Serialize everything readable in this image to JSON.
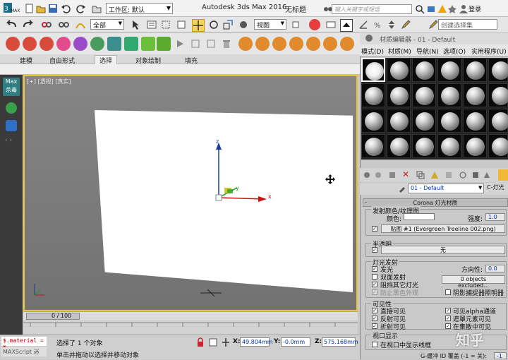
{
  "titlebar": {
    "workspace_label": "工作区: 默认",
    "app_title": "Autodesk 3ds Max 2016",
    "doc_title": "无标题",
    "search_placeholder": "键入关键字或短语",
    "login": "登录",
    "logo": "MAX"
  },
  "toolbar": {
    "selection_filter": "全部",
    "reference_coord": "视图",
    "named_selection": "创建选择集"
  },
  "ribbon": {
    "tabs": [
      "建模",
      "自由形式",
      "选择",
      "对象绘制",
      "填充"
    ],
    "active_tab": "选择"
  },
  "left_panel": {
    "max_badge_line1": "Max",
    "max_badge_line2": "杀毒"
  },
  "viewport": {
    "label": "[+] [透视] [真实]",
    "axis_z": "z",
    "axis_x": "x",
    "axis_y": "y"
  },
  "timeline": {
    "frame_label": "0 / 100"
  },
  "status": {
    "maxscript_input": "$.material = m",
    "maxscript_label": "MAXScript 迷",
    "selected_text": "选择了 1 个对象",
    "prompt_text": "单击并拖动以选择并移动对象",
    "x_label": "X:",
    "x_value": "49.804mm",
    "y_label": "Y:",
    "y_value": "-0.0mm",
    "z_label": "Z:",
    "z_value": "575.168mm"
  },
  "material_editor": {
    "title": "材质编辑器 - 01 - Default",
    "menu": [
      "模式(D)",
      "材质(M)",
      "导航(N)",
      "选项(O)",
      "实用程序(U)"
    ],
    "material_name": "01 - Default",
    "material_type": "C-灯光",
    "rollout_title": "Corona 灯光材质",
    "emission": {
      "group_title": "发射颜色/纹理图",
      "color_label": "颜色:",
      "intensity_label": "强度:",
      "intensity_value": "1.0",
      "map_label": "贴图 #1 (Evergreen Treeline 002.png)"
    },
    "opacity": {
      "group_title": "半透明",
      "value": "无"
    },
    "emit_light": {
      "group_title": "灯光发射",
      "emit": "发光",
      "two_sided": "双面发射",
      "occlude_other": "阻挡其它灯光",
      "disabled_option": "防止黑色外观",
      "directionality_label": "方向性:",
      "directionality_value": "0.0",
      "excluded": "0 objects excluded...",
      "shadow_catcher": "阴影捕捉器照明器"
    },
    "visibility": {
      "group_title": "可见性",
      "direct": "直接可见",
      "reflect": "反射可见",
      "refract": "折射可见",
      "alpha": "可见alpha通道",
      "masks": "遮罩元素可见",
      "in_masks": "在集散中可见"
    },
    "viewport_display": {
      "group_title": "视口显示",
      "wireframe": "在视口中显示线框"
    },
    "gbuffer_label": "G-缓冲 ID 覆盖 (-1 = 关):",
    "gbuffer_value": "-1"
  },
  "watermark": "知乎"
}
